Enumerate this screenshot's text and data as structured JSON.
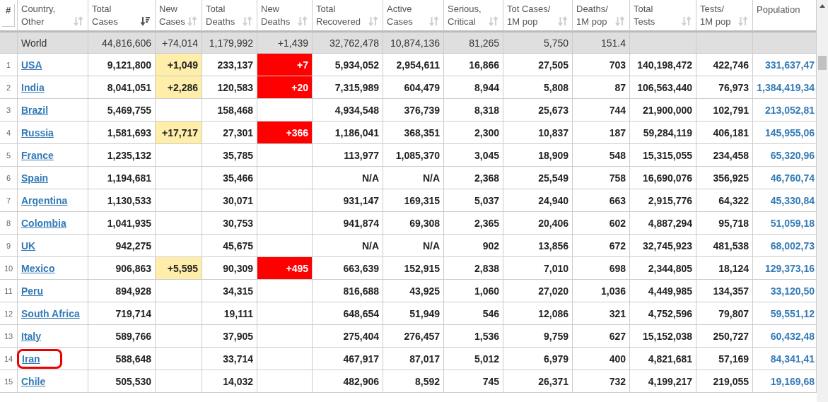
{
  "columns": [
    {
      "label": "#",
      "kind": "rank"
    },
    {
      "label": "Country,\nOther",
      "kind": "country",
      "sorted": false
    },
    {
      "label": "Total\nCases",
      "kind": "number",
      "sorted": true
    },
    {
      "label": "New\nCases",
      "kind": "new_cases",
      "sorted": false
    },
    {
      "label": "Total\nDeaths",
      "kind": "number",
      "sorted": false
    },
    {
      "label": "New\nDeaths",
      "kind": "new_deaths",
      "sorted": false
    },
    {
      "label": "Total\nRecovered",
      "kind": "number",
      "sorted": false
    },
    {
      "label": "Active\nCases",
      "kind": "number",
      "sorted": false
    },
    {
      "label": "Serious,\nCritical",
      "kind": "number",
      "sorted": false
    },
    {
      "label": "Tot Cases/\n1M pop",
      "kind": "number",
      "sorted": false
    },
    {
      "label": "Deaths/\n1M pop",
      "kind": "number",
      "sorted": false
    },
    {
      "label": "Total\nTests",
      "kind": "number",
      "sorted": false
    },
    {
      "label": "Tests/\n1M pop",
      "kind": "number",
      "sorted": false
    },
    {
      "label": "Population",
      "kind": "population"
    }
  ],
  "world": {
    "country": "World",
    "total_cases": "44,816,606",
    "new_cases": "+74,014",
    "total_deaths": "1,179,992",
    "new_deaths": "+1,439",
    "total_recovered": "32,762,478",
    "active_cases": "10,874,136",
    "serious_critical": "81,265",
    "tot_cases_per_1m": "5,750",
    "deaths_per_1m": "151.4"
  },
  "rows": [
    {
      "rank": "1",
      "country": "USA",
      "highlighted": false,
      "total_cases": "9,121,800",
      "new_cases": "+1,049",
      "total_deaths": "233,137",
      "new_deaths": "+7",
      "total_recovered": "5,934,052",
      "active_cases": "2,954,611",
      "serious_critical": "16,866",
      "tot_cases_per_1m": "27,505",
      "deaths_per_1m": "703",
      "total_tests": "140,198,472",
      "tests_per_1m": "422,746",
      "population": "331,637,47"
    },
    {
      "rank": "2",
      "country": "India",
      "highlighted": false,
      "total_cases": "8,041,051",
      "new_cases": "+2,286",
      "total_deaths": "120,583",
      "new_deaths": "+20",
      "total_recovered": "7,315,989",
      "active_cases": "604,479",
      "serious_critical": "8,944",
      "tot_cases_per_1m": "5,808",
      "deaths_per_1m": "87",
      "total_tests": "106,563,440",
      "tests_per_1m": "76,973",
      "population": "1,384,419,34"
    },
    {
      "rank": "3",
      "country": "Brazil",
      "highlighted": false,
      "total_cases": "5,469,755",
      "total_deaths": "158,468",
      "total_recovered": "4,934,548",
      "active_cases": "376,739",
      "serious_critical": "8,318",
      "tot_cases_per_1m": "25,673",
      "deaths_per_1m": "744",
      "total_tests": "21,900,000",
      "tests_per_1m": "102,791",
      "population": "213,052,81"
    },
    {
      "rank": "4",
      "country": "Russia",
      "highlighted": false,
      "total_cases": "1,581,693",
      "new_cases": "+17,717",
      "total_deaths": "27,301",
      "new_deaths": "+366",
      "total_recovered": "1,186,041",
      "active_cases": "368,351",
      "serious_critical": "2,300",
      "tot_cases_per_1m": "10,837",
      "deaths_per_1m": "187",
      "total_tests": "59,284,119",
      "tests_per_1m": "406,181",
      "population": "145,955,06"
    },
    {
      "rank": "5",
      "country": "France",
      "highlighted": false,
      "total_cases": "1,235,132",
      "total_deaths": "35,785",
      "total_recovered": "113,977",
      "active_cases": "1,085,370",
      "serious_critical": "3,045",
      "tot_cases_per_1m": "18,909",
      "deaths_per_1m": "548",
      "total_tests": "15,315,055",
      "tests_per_1m": "234,458",
      "population": "65,320,96"
    },
    {
      "rank": "6",
      "country": "Spain",
      "highlighted": false,
      "total_cases": "1,194,681",
      "total_deaths": "35,466",
      "total_recovered": "N/A",
      "active_cases": "N/A",
      "serious_critical": "2,368",
      "tot_cases_per_1m": "25,549",
      "deaths_per_1m": "758",
      "total_tests": "16,690,076",
      "tests_per_1m": "356,925",
      "population": "46,760,74"
    },
    {
      "rank": "7",
      "country": "Argentina",
      "highlighted": false,
      "total_cases": "1,130,533",
      "total_deaths": "30,071",
      "total_recovered": "931,147",
      "active_cases": "169,315",
      "serious_critical": "5,037",
      "tot_cases_per_1m": "24,940",
      "deaths_per_1m": "663",
      "total_tests": "2,915,776",
      "tests_per_1m": "64,322",
      "population": "45,330,84"
    },
    {
      "rank": "8",
      "country": "Colombia",
      "highlighted": false,
      "total_cases": "1,041,935",
      "total_deaths": "30,753",
      "total_recovered": "941,874",
      "active_cases": "69,308",
      "serious_critical": "2,365",
      "tot_cases_per_1m": "20,406",
      "deaths_per_1m": "602",
      "total_tests": "4,887,294",
      "tests_per_1m": "95,718",
      "population": "51,059,18"
    },
    {
      "rank": "9",
      "country": "UK",
      "highlighted": false,
      "total_cases": "942,275",
      "total_deaths": "45,675",
      "total_recovered": "N/A",
      "active_cases": "N/A",
      "serious_critical": "902",
      "tot_cases_per_1m": "13,856",
      "deaths_per_1m": "672",
      "total_tests": "32,745,923",
      "tests_per_1m": "481,538",
      "population": "68,002,73"
    },
    {
      "rank": "10",
      "country": "Mexico",
      "highlighted": false,
      "total_cases": "906,863",
      "new_cases": "+5,595",
      "total_deaths": "90,309",
      "new_deaths": "+495",
      "total_recovered": "663,639",
      "active_cases": "152,915",
      "serious_critical": "2,838",
      "tot_cases_per_1m": "7,010",
      "deaths_per_1m": "698",
      "total_tests": "2,344,805",
      "tests_per_1m": "18,124",
      "population": "129,373,16"
    },
    {
      "rank": "11",
      "country": "Peru",
      "highlighted": false,
      "total_cases": "894,928",
      "total_deaths": "34,315",
      "total_recovered": "816,688",
      "active_cases": "43,925",
      "serious_critical": "1,060",
      "tot_cases_per_1m": "27,020",
      "deaths_per_1m": "1,036",
      "total_tests": "4,449,985",
      "tests_per_1m": "134,357",
      "population": "33,120,50"
    },
    {
      "rank": "12",
      "country": "South Africa",
      "highlighted": false,
      "total_cases": "719,714",
      "total_deaths": "19,111",
      "total_recovered": "648,654",
      "active_cases": "51,949",
      "serious_critical": "546",
      "tot_cases_per_1m": "12,086",
      "deaths_per_1m": "321",
      "total_tests": "4,752,596",
      "tests_per_1m": "79,807",
      "population": "59,551,12"
    },
    {
      "rank": "13",
      "country": "Italy",
      "highlighted": false,
      "total_cases": "589,766",
      "total_deaths": "37,905",
      "total_recovered": "275,404",
      "active_cases": "276,457",
      "serious_critical": "1,536",
      "tot_cases_per_1m": "9,759",
      "deaths_per_1m": "627",
      "total_tests": "15,152,038",
      "tests_per_1m": "250,727",
      "population": "60,432,48"
    },
    {
      "rank": "14",
      "country": "Iran",
      "highlighted": true,
      "total_cases": "588,648",
      "total_deaths": "33,714",
      "total_recovered": "467,917",
      "active_cases": "87,017",
      "serious_critical": "5,012",
      "tot_cases_per_1m": "6,979",
      "deaths_per_1m": "400",
      "total_tests": "4,821,681",
      "tests_per_1m": "57,169",
      "population": "84,341,41"
    },
    {
      "rank": "15",
      "country": "Chile",
      "highlighted": false,
      "total_cases": "505,530",
      "total_deaths": "14,032",
      "total_recovered": "482,906",
      "active_cases": "8,592",
      "serious_critical": "745",
      "tot_cases_per_1m": "26,371",
      "deaths_per_1m": "732",
      "total_tests": "4,199,217",
      "tests_per_1m": "219,055",
      "population": "19,169,68"
    }
  ]
}
